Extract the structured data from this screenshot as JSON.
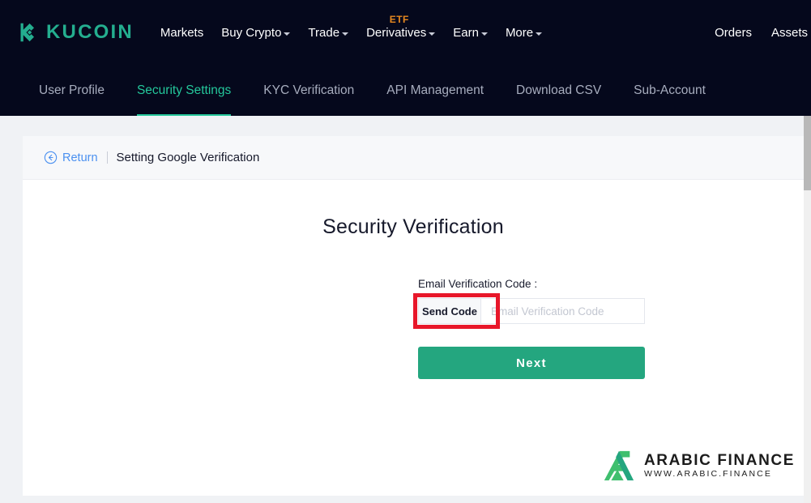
{
  "brand": {
    "name": "KUCOIN",
    "logo_icon": "kucoin-logo-icon",
    "color": "#24ae8f"
  },
  "header": {
    "background": "#05081c",
    "nav": [
      {
        "label": "Markets",
        "has_caret": false,
        "badge": null
      },
      {
        "label": "Buy Crypto",
        "has_caret": true,
        "badge": null
      },
      {
        "label": "Trade",
        "has_caret": true,
        "badge": null
      },
      {
        "label": "Derivatives",
        "has_caret": true,
        "badge": "ETF"
      },
      {
        "label": "Earn",
        "has_caret": true,
        "badge": null
      },
      {
        "label": "More",
        "has_caret": true,
        "badge": null
      }
    ],
    "right_nav": [
      {
        "label": "Orders"
      },
      {
        "label": "Assets"
      }
    ],
    "badge_color": "#e8891f"
  },
  "subnav": {
    "active": "Security Settings",
    "active_color": "#24c79b",
    "tabs": [
      {
        "label": "User Profile",
        "active": false
      },
      {
        "label": "Security Settings",
        "active": true
      },
      {
        "label": "KYC Verification",
        "active": false
      },
      {
        "label": "API Management",
        "active": false
      },
      {
        "label": "Download CSV",
        "active": false
      },
      {
        "label": "Sub-Account",
        "active": false
      }
    ]
  },
  "breadcrumb": {
    "return_label": "Return",
    "return_icon": "circle-arrow-left-icon",
    "return_color": "#4a90f0",
    "title": "Setting Google Verification"
  },
  "main": {
    "heading": "Security Verification",
    "form": {
      "field_label": "Email Verification Code :",
      "send_code_label": "Send Code",
      "code_input_value": "",
      "code_input_placeholder": "Email Verification Code",
      "submit_label": "Next",
      "submit_color": "#24a67f"
    },
    "annotation": {
      "target": "Send Code",
      "color": "#e8172a"
    }
  },
  "watermark": {
    "title": "ARABIC FINANCE",
    "subtitle": "WWW.ARABIC.FINANCE",
    "logo_icon": "arabic-finance-logo-icon"
  }
}
